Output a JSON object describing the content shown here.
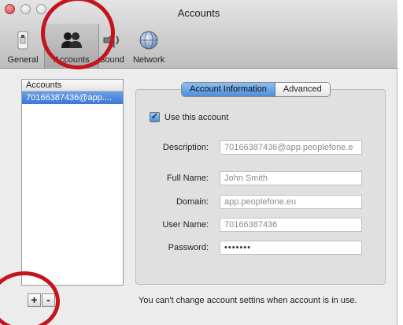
{
  "window": {
    "title": "Accounts"
  },
  "toolbar": {
    "items": [
      {
        "label": "General",
        "icon": "switch-icon"
      },
      {
        "label": "Accounts",
        "icon": "people-icon"
      },
      {
        "label": "Sound",
        "icon": "speaker-icon"
      },
      {
        "label": "Network",
        "icon": "globe-icon"
      }
    ],
    "selected": "Accounts"
  },
  "accounts_list": {
    "header": "Accounts",
    "rows": [
      "70166387436@app...."
    ],
    "add_label": "+",
    "remove_label": "-"
  },
  "tabs": [
    "Account Information",
    "Advanced"
  ],
  "account_form": {
    "use_account_label": "Use this account",
    "use_account_checked": true,
    "description_label": "Description:",
    "description_value": "70166387436@app.peoplefone.e",
    "full_name_label": "Full Name:",
    "full_name_placeholder": "John Smith",
    "domain_label": "Domain:",
    "domain_placeholder": "app.peoplefone.eu",
    "user_name_label": "User Name:",
    "user_name_value": "70166387436",
    "password_label": "Password:",
    "password_value": "•••••••"
  },
  "footer_note": "You can't change account settins when account is in use.",
  "colors": {
    "highlight_ring": "#c4141c",
    "selection": "#3a76d4"
  }
}
